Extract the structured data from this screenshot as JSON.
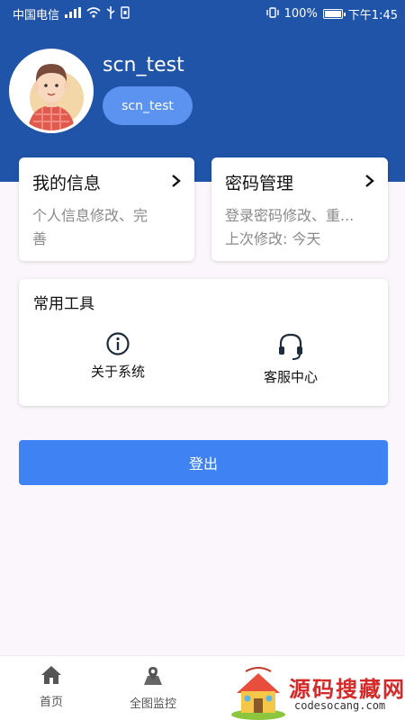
{
  "status_bar": {
    "carrier": "中国电信",
    "battery_level": "100%",
    "time": "下午1:45"
  },
  "profile": {
    "username": "scn_test",
    "badge": "scn_test"
  },
  "cards": {
    "info": {
      "title": "我的信息",
      "desc_line1": "个人信息修改、完",
      "desc_line2": "善"
    },
    "password": {
      "title": "密码管理",
      "desc_line1": "登录密码修改、重...",
      "desc_line2": "上次修改: 今天"
    }
  },
  "tools": {
    "title": "常用工具",
    "items": [
      {
        "label": "关于系统",
        "icon": "info-icon"
      },
      {
        "label": "客服中心",
        "icon": "headset-icon"
      }
    ]
  },
  "logout_label": "登出",
  "tabbar": {
    "items": [
      {
        "label": "首页",
        "icon": "home-icon"
      },
      {
        "label": "全图监控",
        "icon": "map-icon"
      }
    ]
  },
  "watermark": {
    "title": "源码搜藏网",
    "url": "codesocang.com"
  },
  "colors": {
    "header_blue": "#1f54a8",
    "badge_blue": "#5c93f0",
    "button_blue": "#3f82f4",
    "page_bg": "#faf6fb"
  }
}
